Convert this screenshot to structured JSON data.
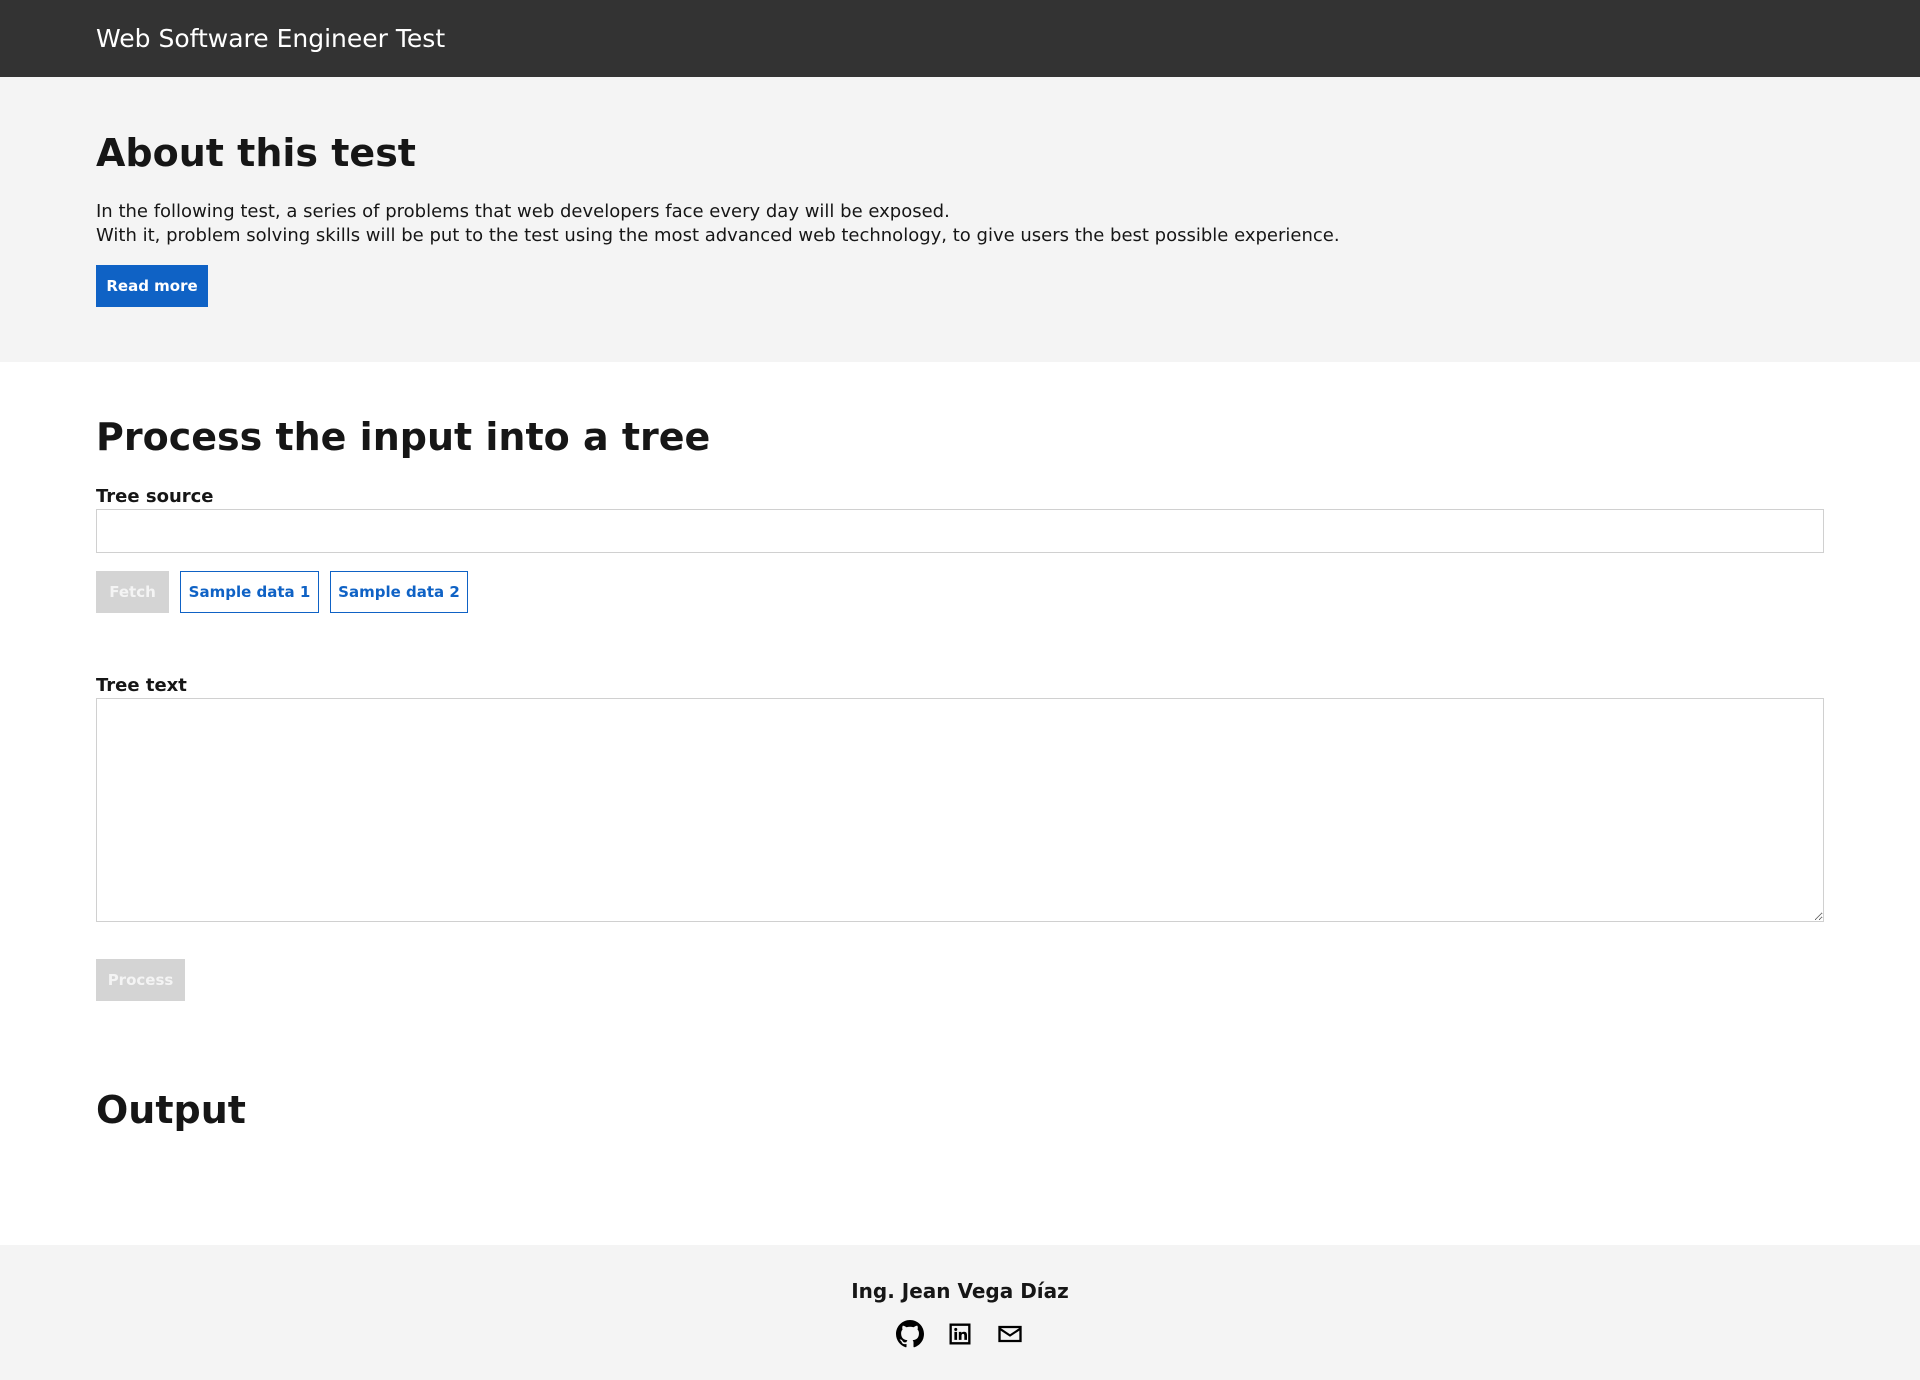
{
  "header": {
    "title": "Web Software Engineer Test"
  },
  "about": {
    "heading": "About this test",
    "line1": "In the following test, a series of problems that web developers face every day will be exposed.",
    "line2": "With it, problem solving skills will be put to the test using the most advanced web technology, to give users the best possible experience.",
    "read_more_label": "Read more"
  },
  "process": {
    "heading": "Process the input into a tree",
    "tree_source_label": "Tree source",
    "tree_source_value": "",
    "fetch_label": "Fetch",
    "sample1_label": "Sample data 1",
    "sample2_label": "Sample data 2",
    "tree_text_label": "Tree text",
    "tree_text_value": "",
    "process_label": "Process"
  },
  "output": {
    "heading": "Output"
  },
  "footer": {
    "author": "Ing. Jean Vega Díaz",
    "icons": [
      "github-icon",
      "linkedin-icon",
      "mail-icon"
    ]
  },
  "colors": {
    "header_bg": "#333333",
    "section_bg": "#f4f4f4",
    "primary": "#0f62c5",
    "disabled": "#d4d4d4"
  }
}
